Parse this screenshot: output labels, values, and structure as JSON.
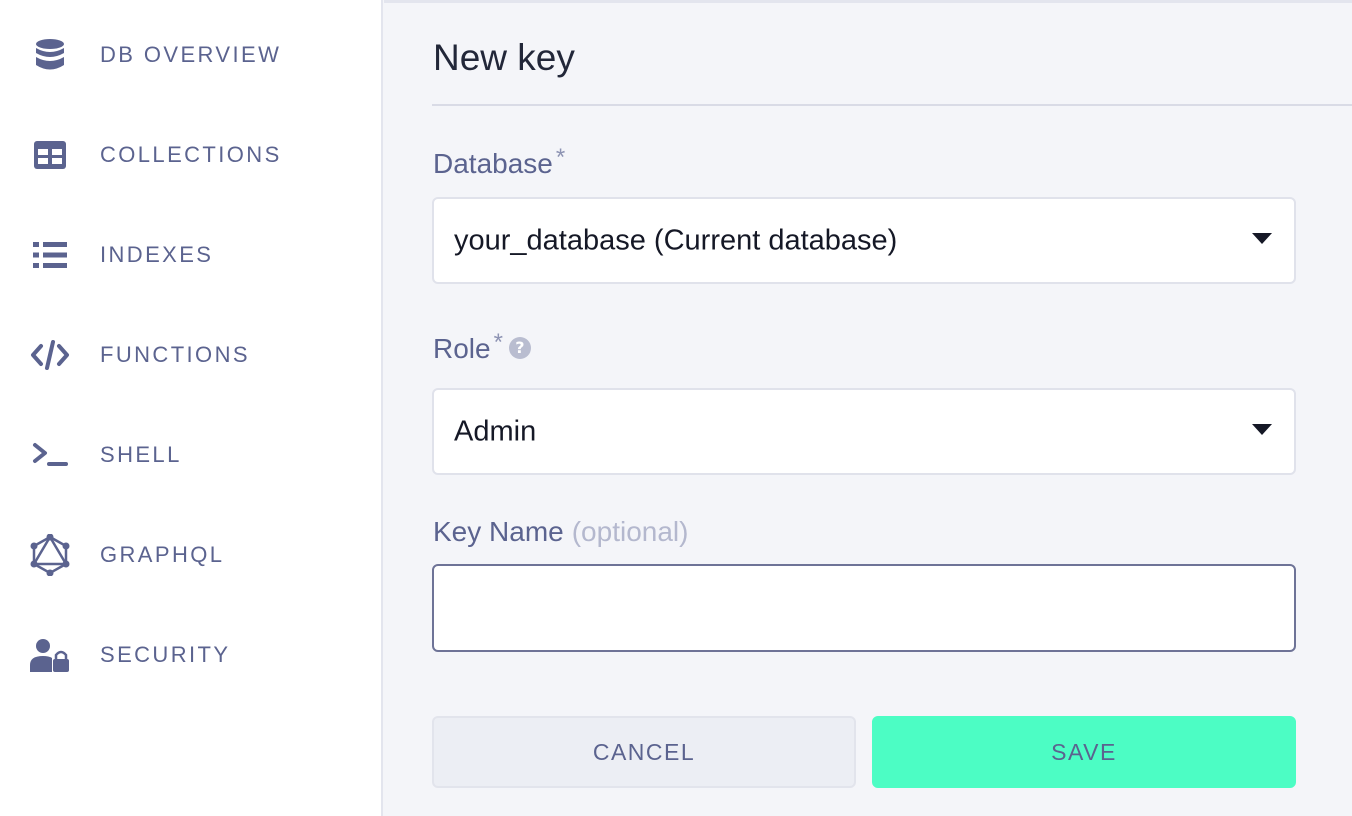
{
  "sidebar": {
    "items": [
      {
        "label": "DB OVERVIEW",
        "icon": "database-icon"
      },
      {
        "label": "COLLECTIONS",
        "icon": "table-grid-icon"
      },
      {
        "label": "INDEXES",
        "icon": "list-icon"
      },
      {
        "label": "FUNCTIONS",
        "icon": "code-icon"
      },
      {
        "label": "SHELL",
        "icon": "terminal-icon"
      },
      {
        "label": "GRAPHQL",
        "icon": "graphql-icon"
      },
      {
        "label": "SECURITY",
        "icon": "user-lock-icon"
      }
    ]
  },
  "main": {
    "title": "New key",
    "database": {
      "label": "Database",
      "required_mark": "*",
      "value": "your_database (Current database)"
    },
    "role": {
      "label": "Role",
      "required_mark": "*",
      "help_icon": "?",
      "value": "Admin"
    },
    "key_name": {
      "label": "Key Name",
      "optional_hint": "(optional)",
      "value": ""
    },
    "buttons": {
      "cancel": "CANCEL",
      "save": "SAVE"
    }
  },
  "colors": {
    "sidebar_text": "#5b638f",
    "title_text": "#222739",
    "save_button": "#4cfdc4",
    "cancel_button": "#eceef4",
    "background": "#f4f5f9"
  }
}
